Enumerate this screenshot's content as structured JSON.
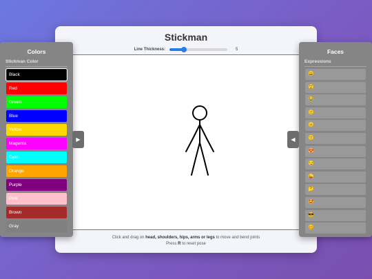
{
  "app": {
    "title": "Stickman",
    "thickness_label": "Line Thickness:",
    "thickness_value": 5,
    "thickness_fraction": 0.25
  },
  "colors_panel": {
    "title": "Colors",
    "subtitle": "Stickman Color",
    "toggle_glyph": "▶",
    "swatches": [
      {
        "label": "Black",
        "color": "#000000",
        "selected": true
      },
      {
        "label": "Red",
        "color": "#ff0000"
      },
      {
        "label": "Green",
        "color": "#00ff00"
      },
      {
        "label": "Blue",
        "color": "#0000ff"
      },
      {
        "label": "Yellow",
        "color": "#ffd700"
      },
      {
        "label": "Magenta",
        "color": "#ff00ff"
      },
      {
        "label": "Cyan",
        "color": "#00ffff"
      },
      {
        "label": "Orange",
        "color": "#ffa500"
      },
      {
        "label": "Purple",
        "color": "#800080"
      },
      {
        "label": "Pink",
        "color": "#ffc0cb"
      },
      {
        "label": "Brown",
        "color": "#a52a2a"
      },
      {
        "label": "Gray",
        "color": "#808080"
      }
    ]
  },
  "faces_panel": {
    "title": "Faces",
    "subtitle": "Expressions",
    "toggle_glyph": "◀",
    "faces": [
      {
        "emoji": "😀",
        "icon": "grinning-face-icon"
      },
      {
        "emoji": "😲",
        "icon": "astonished-face-icon"
      },
      {
        "emoji": "😂",
        "icon": "tears-of-joy-face-icon"
      },
      {
        "emoji": "🙂",
        "icon": "slight-smile-face-icon"
      },
      {
        "emoji": "😐",
        "icon": "neutral-face-icon"
      },
      {
        "emoji": "🙁",
        "icon": "frowning-face-icon"
      },
      {
        "emoji": "😍",
        "icon": "heart-eyes-face-icon"
      },
      {
        "emoji": "😏",
        "icon": "smirk-face-icon"
      },
      {
        "emoji": "😜",
        "icon": "winking-tongue-face-icon"
      },
      {
        "emoji": "🤔",
        "icon": "thinking-face-icon"
      },
      {
        "emoji": "🤩",
        "icon": "star-struck-face-icon"
      },
      {
        "emoji": "😎",
        "icon": "sunglasses-face-icon"
      },
      {
        "emoji": "🥴",
        "icon": "woozy-face-icon"
      }
    ]
  },
  "help": {
    "line1_prefix": "Click and drag on ",
    "line1_parts": "head, shoulders, hips, arms or legs",
    "line1_suffix": " to move and bend joints",
    "line2_prefix": "Press ",
    "line2_key": "R",
    "line2_suffix": " to reset pose"
  },
  "stickman": {
    "color": "#000000"
  }
}
